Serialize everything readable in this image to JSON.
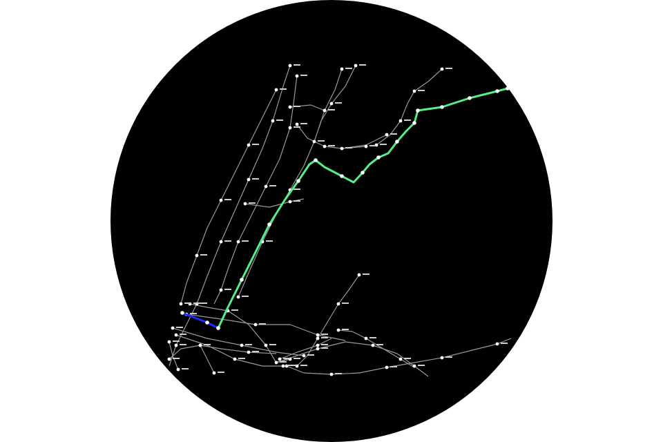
{
  "colors": {
    "page_background": "#ffffff",
    "map_background": "#000000",
    "base_line": "#9a9a9a",
    "station": "#ffffff",
    "highlight_route_green": "#55ee88",
    "highlight_route_blue": "#1a2cff"
  },
  "map": {
    "view": "circular-viewport",
    "highlighted_routes": [
      {
        "color": "green",
        "station_count": 15
      },
      {
        "color": "blue",
        "station_count": 3
      }
    ]
  }
}
